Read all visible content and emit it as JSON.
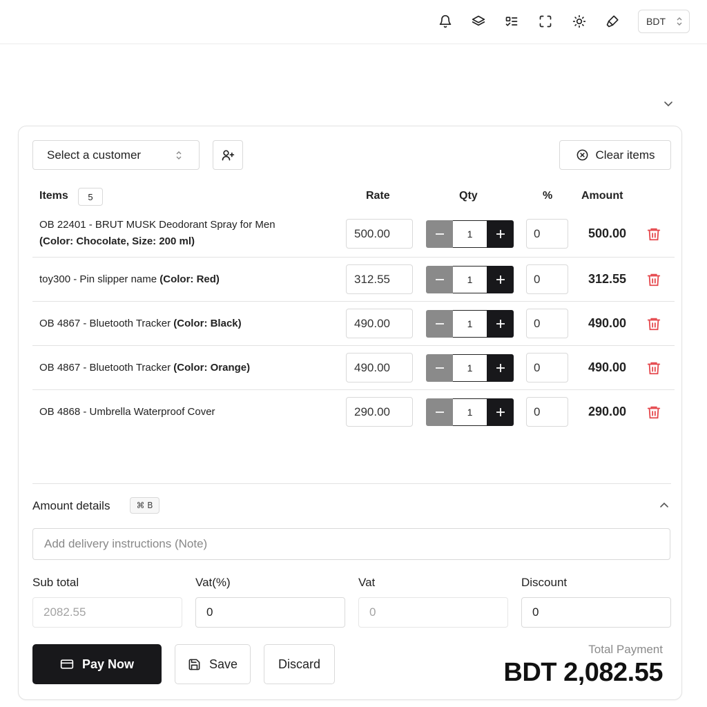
{
  "topbar": {
    "icons": [
      "bell-icon",
      "layers-icon",
      "checklist-icon",
      "fullscreen-icon",
      "sun-icon",
      "paintbrush-icon"
    ],
    "currency": "BDT"
  },
  "customer": {
    "placeholder": "Select a customer"
  },
  "clear_items_label": "Clear items",
  "table": {
    "headers": {
      "items": "Items",
      "rate": "Rate",
      "qty": "Qty",
      "percent": "%",
      "amount": "Amount"
    },
    "items_count": "5",
    "rows": [
      {
        "name": "OB 22401 - BRUT MUSK Deodorant Spray for Men",
        "variant": "(Color: Chocolate, Size: 200 ml)",
        "rate": "500.00",
        "qty": "1",
        "percent": "0",
        "amount": "500.00"
      },
      {
        "name": "toy300 - Pin slipper name",
        "variant": "(Color: Red)",
        "rate": "312.55",
        "qty": "1",
        "percent": "0",
        "amount": "312.55"
      },
      {
        "name": "OB 4867 - Bluetooth Tracker",
        "variant": "(Color: Black)",
        "rate": "490.00",
        "qty": "1",
        "percent": "0",
        "amount": "490.00"
      },
      {
        "name": "OB 4867 - Bluetooth Tracker",
        "variant": "(Color: Orange)",
        "rate": "490.00",
        "qty": "1",
        "percent": "0",
        "amount": "490.00"
      },
      {
        "name": "OB 4868 - Umbrella Waterproof Cover",
        "variant": "",
        "rate": "290.00",
        "qty": "1",
        "percent": "0",
        "amount": "290.00"
      }
    ]
  },
  "amount_details": {
    "label": "Amount details",
    "shortcut": "⌘ B",
    "note_placeholder": "Add delivery instructions (Note)",
    "subtotal_label": "Sub total",
    "subtotal_value": "2082.55",
    "vat_percent_label": "Vat(%)",
    "vat_percent_value": "0",
    "vat_label": "Vat",
    "vat_value": "0",
    "discount_label": "Discount",
    "discount_value": "0"
  },
  "actions": {
    "pay_now": "Pay Now",
    "save": "Save",
    "discard": "Discard"
  },
  "total": {
    "label": "Total Payment",
    "value": "BDT 2,082.55"
  },
  "colors": {
    "primary": "#18181b",
    "delete_red": "#e5484d",
    "minus_gray": "#8a8a8a",
    "border": "#d9d9d9"
  }
}
